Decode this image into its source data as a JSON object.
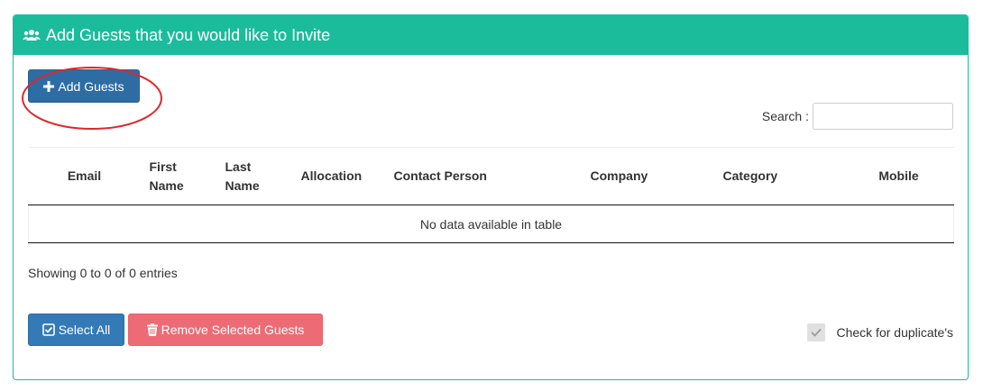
{
  "panel": {
    "title": "Add Guests that you would like to Invite",
    "icon": "users-icon",
    "accent_color": "#1abc9c"
  },
  "toolbar": {
    "add_label": "Add Guests",
    "add_color": "#2e6da4",
    "annotation_color": "#e0262c"
  },
  "search": {
    "label": "Search :",
    "value": "",
    "placeholder": ""
  },
  "table": {
    "columns": [
      "Email",
      "First Name",
      "Last Name",
      "Allocation",
      "Contact Person",
      "Company",
      "Category",
      "Mobile"
    ],
    "empty_message": "No data available in table",
    "rows": []
  },
  "info": {
    "text": "Showing 0 to 0 of 0 entries"
  },
  "actions": {
    "select_all_label": "Select All",
    "select_all_color": "#337ab7",
    "remove_label": "Remove Selected Guests",
    "remove_color": "#ed6b75"
  },
  "duplicates": {
    "label": "Check for duplicate's",
    "checked": true
  }
}
